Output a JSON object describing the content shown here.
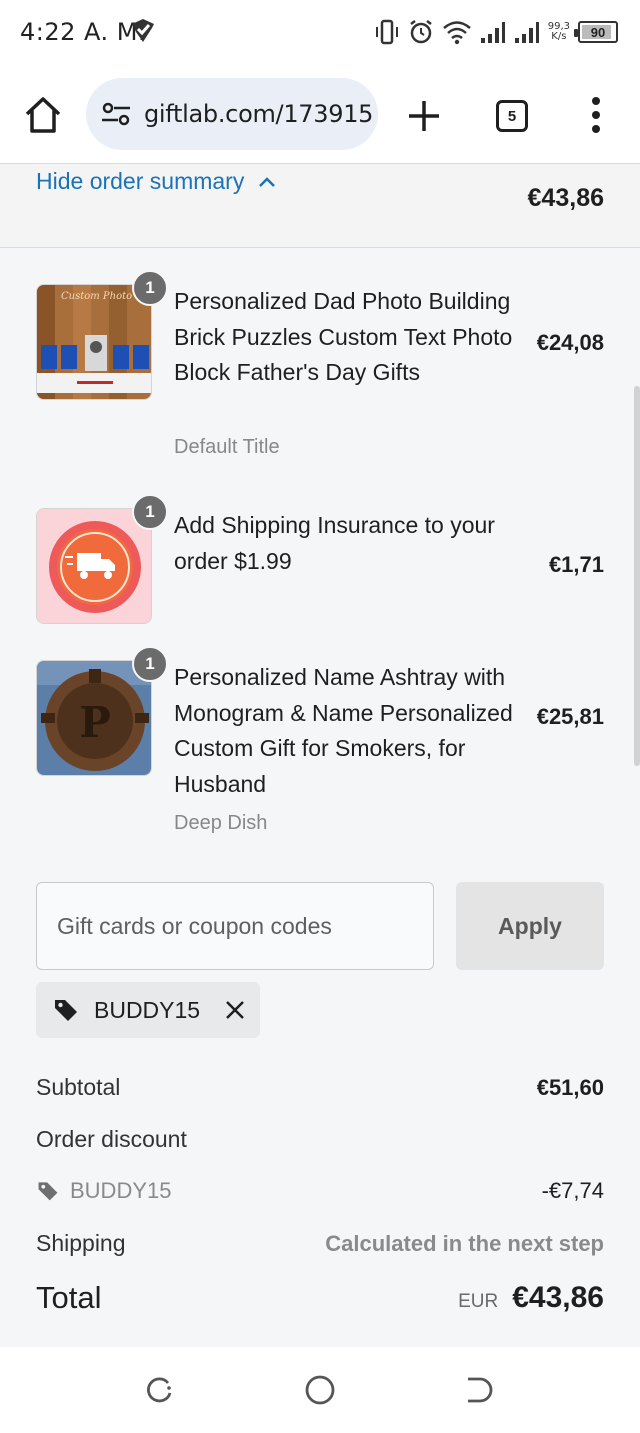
{
  "status_bar": {
    "time": "4:22 A. M.",
    "net_speed_value": "99,3",
    "net_speed_unit": "K/s",
    "battery": "90",
    "battery_level": 0.9,
    "icons": [
      "shield-check-icon",
      "vibrate-icon",
      "alarm-icon",
      "wifi-icon",
      "signal-icon",
      "signal-icon",
      "battery-icon"
    ]
  },
  "browser": {
    "url": "giftlab.com/173915",
    "tab_count": "5",
    "icons": [
      "home-icon",
      "site-settings-icon",
      "plus-icon",
      "more-vert-icon"
    ]
  },
  "summary": {
    "toggle_label": "Hide order summary",
    "header_total": "€43,86",
    "accent_color": "#1a73b8"
  },
  "items": [
    {
      "qty": "1",
      "title": "Personalized Dad Photo Building Brick Puzzles Custom Text Photo Block Father's Day Gifts",
      "variant": "Default Title",
      "price": "€24,08",
      "thumb_text": "Custom Photo & Text"
    },
    {
      "qty": "1",
      "title": "Add Shipping Insurance to your order $1.99",
      "variant": "",
      "price": "€1,71"
    },
    {
      "qty": "1",
      "title": "Personalized Name Ashtray with Monogram & Name Personalized Custom Gift for Smokers, for Husband",
      "variant": "Deep Dish",
      "price": "€25,81",
      "thumb_text": "P"
    }
  ],
  "coupon": {
    "placeholder": "Gift cards or coupon codes",
    "apply_label": "Apply",
    "applied_code": "BUDDY15"
  },
  "totals": {
    "subtotal_label": "Subtotal",
    "subtotal_value": "€51,60",
    "discount_label": "Order discount",
    "discount_code": "BUDDY15",
    "discount_value": "-€7,74",
    "shipping_label": "Shipping",
    "shipping_value": "Calculated in the next step",
    "total_label": "Total",
    "total_currency": "EUR",
    "total_value": "€43,86"
  },
  "nav_bar": {
    "icons": [
      "recents-icon",
      "home-circle-icon",
      "back-icon"
    ]
  }
}
